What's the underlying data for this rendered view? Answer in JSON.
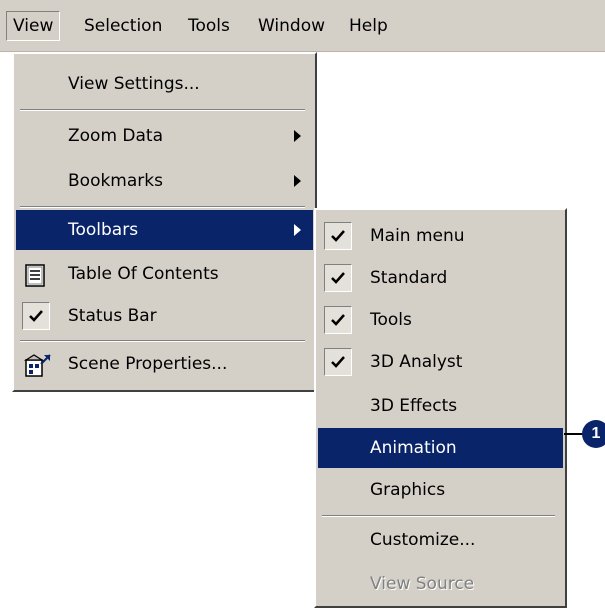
{
  "menubar": {
    "items": [
      "View",
      "Selection",
      "Tools",
      "Window",
      "Help"
    ]
  },
  "view_menu": {
    "items": [
      {
        "label": "View Settings..."
      },
      {
        "label": "Zoom Data"
      },
      {
        "label": "Bookmarks"
      },
      {
        "label": "Toolbars"
      },
      {
        "label": "Table Of Contents"
      },
      {
        "label": "Status Bar"
      },
      {
        "label": "Scene Properties..."
      }
    ]
  },
  "toolbars_menu": {
    "items": [
      {
        "label": "Main menu",
        "checked": true
      },
      {
        "label": "Standard",
        "checked": true
      },
      {
        "label": "Tools",
        "checked": true
      },
      {
        "label": "3D Analyst",
        "checked": true
      },
      {
        "label": "3D Effects",
        "checked": false
      },
      {
        "label": "Animation",
        "checked": false
      },
      {
        "label": "Graphics",
        "checked": false
      },
      {
        "label": "Customize...",
        "checked": false
      },
      {
        "label": "View Source",
        "checked": false,
        "disabled": true
      }
    ]
  },
  "callout": {
    "number": "1"
  },
  "colors": {
    "menu_bg": "#d4d0c8",
    "highlight": "#0a246a",
    "callout": "#0a246a"
  }
}
